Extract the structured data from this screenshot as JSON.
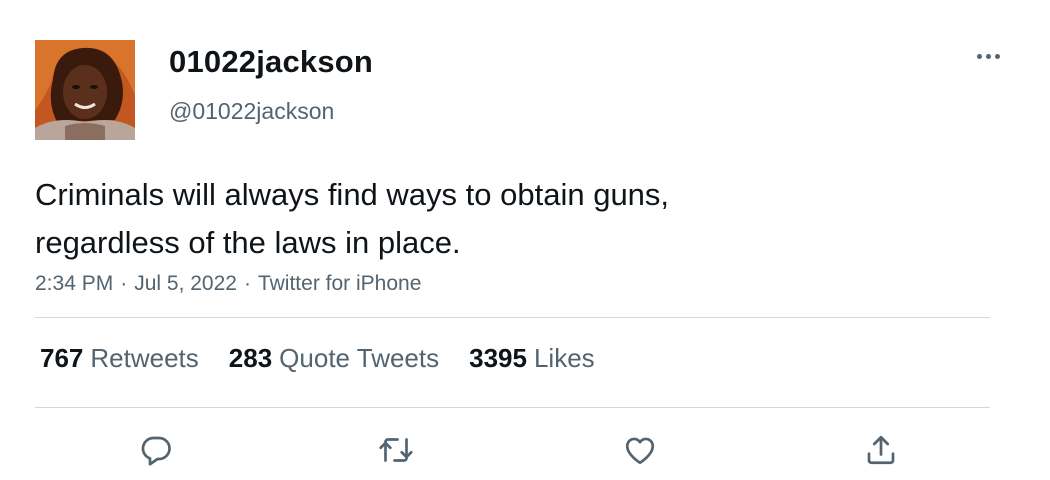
{
  "user": {
    "display_name": "01022jackson",
    "handle": "@01022jackson"
  },
  "tweet": {
    "text_lines": [
      "Criminals will always find ways to obtain guns,",
      "regardless of the laws in place."
    ],
    "time": "2:34 PM",
    "date": "Jul 5, 2022",
    "source": "Twitter for iPhone",
    "separator": "·"
  },
  "stats": {
    "retweets": {
      "count": "767",
      "label": "Retweets"
    },
    "quote_tweets": {
      "count": "283",
      "label": "Quote Tweets"
    },
    "likes": {
      "count": "3395",
      "label": "Likes"
    }
  },
  "icons": {
    "more": "more-horizontal-icon",
    "reply": "reply-icon",
    "retweet": "retweet-icon",
    "like": "heart-icon",
    "share": "share-icon"
  },
  "colors": {
    "text_primary": "#0f1419",
    "text_secondary": "#536471",
    "divider": "#cfd9de"
  }
}
